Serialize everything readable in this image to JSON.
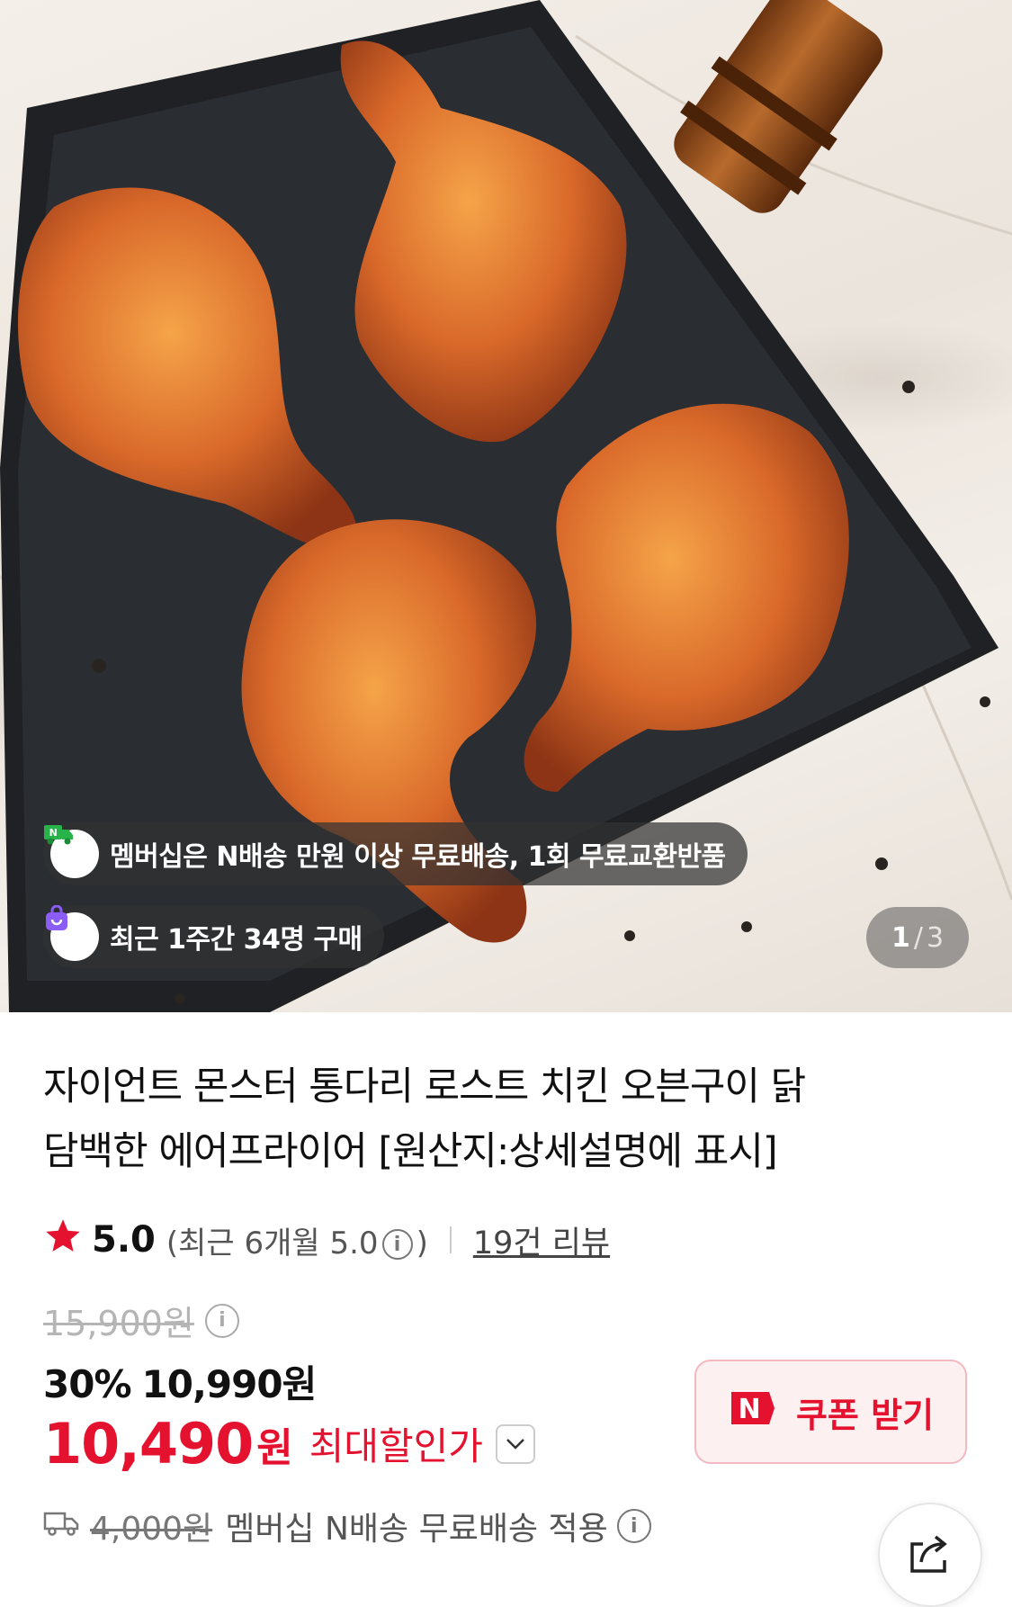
{
  "hero": {
    "membership_notice": "멤버십은 N배송 만원 이상 무료배송, 1회 무료교환반품",
    "purchase_notice": "최근 1주간 34명 구매",
    "counter": {
      "current": "1",
      "separator": "/",
      "total": "3"
    }
  },
  "product": {
    "title_line1": "자이언트 몬스터 통다리 로스트 치킨 오븐구이 닭",
    "title_line2": "담백한 에어프라이어 [원산지:상세설명에 표시]"
  },
  "rating": {
    "score": "5.0",
    "recent_open": "(최근 6개월 5.0",
    "recent_close": ")",
    "reviews": "19건 리뷰"
  },
  "price": {
    "original": "15,900원",
    "discount_pct": "30%",
    "sale": "10,990원",
    "max_num": "10,490",
    "max_won": "원",
    "max_label": "최대할인가"
  },
  "coupon": {
    "label": "쿠폰 받기",
    "badge": "N"
  },
  "shipping": {
    "fee": "4,000원",
    "text": "멤버십 N배송 무료배송 적용"
  },
  "colors": {
    "accent_red": "#e4112f",
    "coupon_bg": "#fdf0f1",
    "coupon_border": "#f2b9c1",
    "delivery_green": "#27b34a",
    "purchase_purple": "#8b5cf6"
  },
  "icons": {
    "delivery": "truck-icon",
    "purchase": "shopping-bag-icon",
    "star": "star-icon",
    "info": "info-icon",
    "dropdown": "chevron-down-icon",
    "shipping": "truck-outline-icon",
    "share": "share-icon"
  }
}
